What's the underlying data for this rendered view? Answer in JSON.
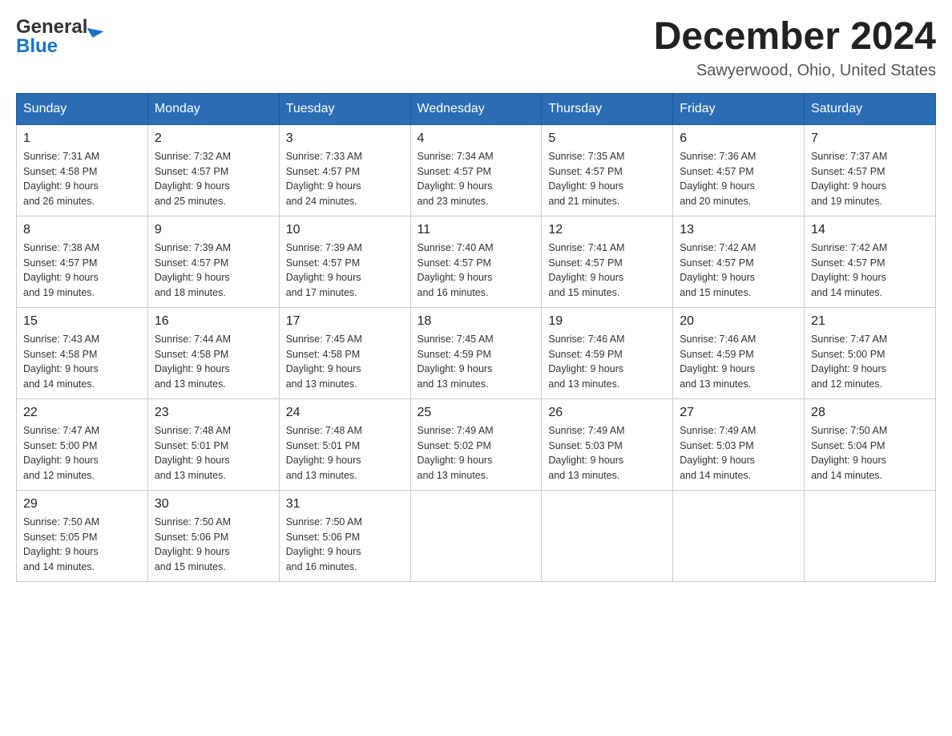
{
  "header": {
    "logo_general": "General",
    "logo_blue": "Blue",
    "title": "December 2024",
    "subtitle": "Sawyerwood, Ohio, United States"
  },
  "calendar": {
    "days_of_week": [
      "Sunday",
      "Monday",
      "Tuesday",
      "Wednesday",
      "Thursday",
      "Friday",
      "Saturday"
    ],
    "weeks": [
      [
        {
          "day": "1",
          "info": "Sunrise: 7:31 AM\nSunset: 4:58 PM\nDaylight: 9 hours\nand 26 minutes."
        },
        {
          "day": "2",
          "info": "Sunrise: 7:32 AM\nSunset: 4:57 PM\nDaylight: 9 hours\nand 25 minutes."
        },
        {
          "day": "3",
          "info": "Sunrise: 7:33 AM\nSunset: 4:57 PM\nDaylight: 9 hours\nand 24 minutes."
        },
        {
          "day": "4",
          "info": "Sunrise: 7:34 AM\nSunset: 4:57 PM\nDaylight: 9 hours\nand 23 minutes."
        },
        {
          "day": "5",
          "info": "Sunrise: 7:35 AM\nSunset: 4:57 PM\nDaylight: 9 hours\nand 21 minutes."
        },
        {
          "day": "6",
          "info": "Sunrise: 7:36 AM\nSunset: 4:57 PM\nDaylight: 9 hours\nand 20 minutes."
        },
        {
          "day": "7",
          "info": "Sunrise: 7:37 AM\nSunset: 4:57 PM\nDaylight: 9 hours\nand 19 minutes."
        }
      ],
      [
        {
          "day": "8",
          "info": "Sunrise: 7:38 AM\nSunset: 4:57 PM\nDaylight: 9 hours\nand 19 minutes."
        },
        {
          "day": "9",
          "info": "Sunrise: 7:39 AM\nSunset: 4:57 PM\nDaylight: 9 hours\nand 18 minutes."
        },
        {
          "day": "10",
          "info": "Sunrise: 7:39 AM\nSunset: 4:57 PM\nDaylight: 9 hours\nand 17 minutes."
        },
        {
          "day": "11",
          "info": "Sunrise: 7:40 AM\nSunset: 4:57 PM\nDaylight: 9 hours\nand 16 minutes."
        },
        {
          "day": "12",
          "info": "Sunrise: 7:41 AM\nSunset: 4:57 PM\nDaylight: 9 hours\nand 15 minutes."
        },
        {
          "day": "13",
          "info": "Sunrise: 7:42 AM\nSunset: 4:57 PM\nDaylight: 9 hours\nand 15 minutes."
        },
        {
          "day": "14",
          "info": "Sunrise: 7:42 AM\nSunset: 4:57 PM\nDaylight: 9 hours\nand 14 minutes."
        }
      ],
      [
        {
          "day": "15",
          "info": "Sunrise: 7:43 AM\nSunset: 4:58 PM\nDaylight: 9 hours\nand 14 minutes."
        },
        {
          "day": "16",
          "info": "Sunrise: 7:44 AM\nSunset: 4:58 PM\nDaylight: 9 hours\nand 13 minutes."
        },
        {
          "day": "17",
          "info": "Sunrise: 7:45 AM\nSunset: 4:58 PM\nDaylight: 9 hours\nand 13 minutes."
        },
        {
          "day": "18",
          "info": "Sunrise: 7:45 AM\nSunset: 4:59 PM\nDaylight: 9 hours\nand 13 minutes."
        },
        {
          "day": "19",
          "info": "Sunrise: 7:46 AM\nSunset: 4:59 PM\nDaylight: 9 hours\nand 13 minutes."
        },
        {
          "day": "20",
          "info": "Sunrise: 7:46 AM\nSunset: 4:59 PM\nDaylight: 9 hours\nand 13 minutes."
        },
        {
          "day": "21",
          "info": "Sunrise: 7:47 AM\nSunset: 5:00 PM\nDaylight: 9 hours\nand 12 minutes."
        }
      ],
      [
        {
          "day": "22",
          "info": "Sunrise: 7:47 AM\nSunset: 5:00 PM\nDaylight: 9 hours\nand 12 minutes."
        },
        {
          "day": "23",
          "info": "Sunrise: 7:48 AM\nSunset: 5:01 PM\nDaylight: 9 hours\nand 13 minutes."
        },
        {
          "day": "24",
          "info": "Sunrise: 7:48 AM\nSunset: 5:01 PM\nDaylight: 9 hours\nand 13 minutes."
        },
        {
          "day": "25",
          "info": "Sunrise: 7:49 AM\nSunset: 5:02 PM\nDaylight: 9 hours\nand 13 minutes."
        },
        {
          "day": "26",
          "info": "Sunrise: 7:49 AM\nSunset: 5:03 PM\nDaylight: 9 hours\nand 13 minutes."
        },
        {
          "day": "27",
          "info": "Sunrise: 7:49 AM\nSunset: 5:03 PM\nDaylight: 9 hours\nand 14 minutes."
        },
        {
          "day": "28",
          "info": "Sunrise: 7:50 AM\nSunset: 5:04 PM\nDaylight: 9 hours\nand 14 minutes."
        }
      ],
      [
        {
          "day": "29",
          "info": "Sunrise: 7:50 AM\nSunset: 5:05 PM\nDaylight: 9 hours\nand 14 minutes."
        },
        {
          "day": "30",
          "info": "Sunrise: 7:50 AM\nSunset: 5:06 PM\nDaylight: 9 hours\nand 15 minutes."
        },
        {
          "day": "31",
          "info": "Sunrise: 7:50 AM\nSunset: 5:06 PM\nDaylight: 9 hours\nand 16 minutes."
        },
        {
          "day": "",
          "info": ""
        },
        {
          "day": "",
          "info": ""
        },
        {
          "day": "",
          "info": ""
        },
        {
          "day": "",
          "info": ""
        }
      ]
    ]
  }
}
